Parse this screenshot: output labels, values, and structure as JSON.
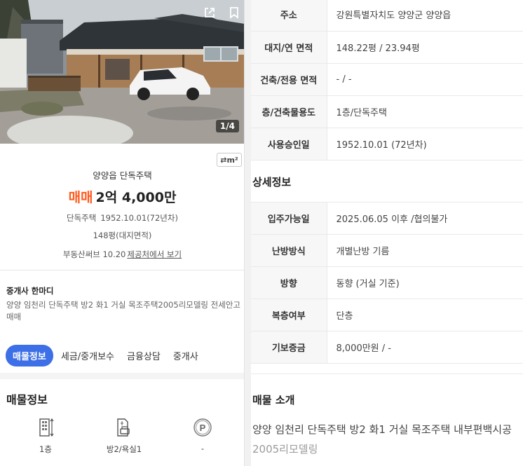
{
  "photo": {
    "counter": "1/4",
    "share_icon": "share-icon",
    "bookmark_icon": "bookmark-icon"
  },
  "unit_toggle": "⇄m²",
  "summary": {
    "title": "양양읍 단독주택",
    "trade_type": "매매",
    "price": "2억 4,000만",
    "type_label": "단독주택",
    "approval": "1952.10.01(72년차)",
    "area": "148평(대지면적)",
    "source_prefix": "부동산써브 10.20",
    "source_link": "제공처에서 보기"
  },
  "agent": {
    "title": "중개사 한마디",
    "text": "양양 임천리 단독주택 방2 화1 거실 목조주택2005리모델링 전세안고매매"
  },
  "tabs": [
    {
      "label": "매물정보",
      "active": true
    },
    {
      "label": "세금/중개보수",
      "active": false
    },
    {
      "label": "금융상담",
      "active": false
    },
    {
      "label": "중개사",
      "active": false
    }
  ],
  "info": {
    "title": "매물정보",
    "items": [
      {
        "icon": "building-floor-icon",
        "label": "1층"
      },
      {
        "icon": "room-bath-icon",
        "label": "방2/욕실1"
      },
      {
        "icon": "parking-icon",
        "label": "-"
      }
    ]
  },
  "basic_table": [
    {
      "key": "주소",
      "value": "강원특별자치도 양양군 양양읍"
    },
    {
      "key": "대지/연 면적",
      "value": "148.22평 / 23.94평"
    },
    {
      "key": "건축/전용 면적",
      "value": "- / -"
    },
    {
      "key": "층/건축물용도",
      "value": "1층/단독주택"
    },
    {
      "key": "사용승인일",
      "value": "1952.10.01 (72년차)"
    }
  ],
  "detail": {
    "title": "상세정보",
    "rows": [
      {
        "key": "입주가능일",
        "value": "2025.06.05 이후 /협의불가"
      },
      {
        "key": "난방방식",
        "value": "개별난방 기름"
      },
      {
        "key": "방향",
        "value": "동향 (거실 기준)"
      },
      {
        "key": "복층여부",
        "value": "단층"
      },
      {
        "key": "기보증금",
        "value": "8,000만원 / -"
      }
    ]
  },
  "intro": {
    "title": "매물 소개",
    "line1": "양양 임천리 단독주택 방2 화1 거실 목조주택 내부편백시공",
    "line2": "2005리모델링"
  },
  "colors": {
    "accent": "#3d6fe6",
    "trade": "#ff5a1e"
  }
}
